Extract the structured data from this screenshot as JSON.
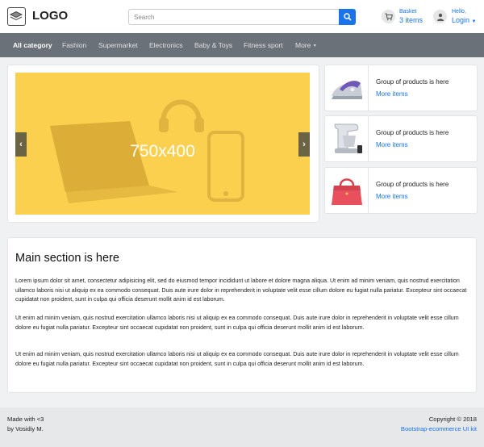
{
  "header": {
    "logo_text": "LOGO",
    "search_placeholder": "Search",
    "basket_label": "Basket",
    "basket_count": "3 items",
    "user_greeting": "Hello,",
    "user_login": "Login",
    "accent_color": "#1a73e8"
  },
  "nav": {
    "items": [
      "All category",
      "Fashion",
      "Supermarket",
      "Electronics",
      "Baby & Toys",
      "Fitness sport",
      "More"
    ]
  },
  "slider": {
    "placeholder_text": "750x400",
    "background_color": "#fcd04f"
  },
  "products": [
    {
      "title": "Group of products is here",
      "link": "More items",
      "icon": "iron-icon"
    },
    {
      "title": "Group of products is here",
      "link": "More items",
      "icon": "mixer-icon"
    },
    {
      "title": "Group of products is here",
      "link": "More items",
      "icon": "handbag-icon"
    }
  ],
  "main": {
    "title": "Main section is here",
    "paragraphs": [
      "Lorem ipsum dolor sit amet, consectetur adipisicing elit, sed do eiusmod tempor incididunt ut labore et dolore magna aliqua. Ut enim ad minim veniam, quis nostrud exercitation ullamco laboris nisi ut aliquip ex ea commodo consequat. Duis aute irure dolor in reprehenderit in voluptate velit esse cillum dolore eu fugiat nulla pariatur. Excepteur sint occaecat cupidatat non proident, sunt in culpa qui officia deserunt mollit anim id est laborum.",
      "Ut enim ad minim veniam, quis nostrud exercitation ullamco laboris nisi ut aliquip ex ea commodo consequat. Duis aute irure dolor in reprehenderit in voluptate velit esse cillum dolore eu fugiat nulla pariatur. Excepteur sint occaecat cupidatat non proident, sunt in culpa qui officia deserunt mollit anim id est laborum.",
      "Ut enim ad minim veniam, quis nostrud exercitation ullamco laboris nisi ut aliquip ex ea commodo consequat. Duis aute irure dolor in reprehenderit in voluptate velit esse cillum dolore eu fugiat nulla pariatur. Excepteur sint occaecat cupidatat non proident, sunt in culpa qui officia deserunt mollit anim id est laborum."
    ]
  },
  "footer": {
    "made_with": "Made with <3",
    "author": "by Vosidiy M.",
    "copyright": "Copyright © 2018",
    "kit_link": "Bootstrap-ecommerce UI kit"
  }
}
